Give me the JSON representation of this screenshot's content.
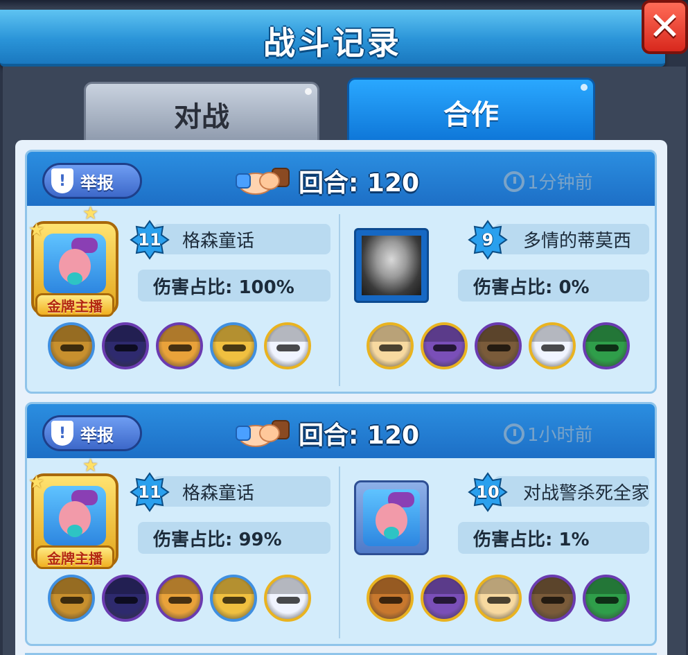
{
  "header": {
    "title": "战斗记录",
    "close_label": "✕"
  },
  "tabs": [
    {
      "label": "对战",
      "active": false
    },
    {
      "label": "合作",
      "active": true
    }
  ],
  "records": [
    {
      "report_label": "举报",
      "rounds_text": "回合: 120",
      "time_text": "1分钟前",
      "left": {
        "level": "11",
        "name": "格森童话",
        "damage_text": "伤害占比: 100%",
        "badge_text": "金牌主播",
        "heroes": [
          {
            "icon": "detective-hero-icon",
            "color": "#c8902e",
            "ring": "blue"
          },
          {
            "icon": "police-hero-icon",
            "color": "#2e2a6e",
            "ring": "purple"
          },
          {
            "icon": "cowboy-hero-icon",
            "color": "#e9a23a",
            "ring": "purple"
          },
          {
            "icon": "knight-hero-icon",
            "color": "#f0c040",
            "ring": "blue"
          },
          {
            "icon": "clown-hero-icon",
            "color": "#f0f4ff",
            "ring": "gold"
          }
        ]
      },
      "right": {
        "level": "9",
        "name": "多情的蒂莫西",
        "damage_text": "伤害占比: 0%",
        "heroes": [
          {
            "icon": "hooded-hero-icon",
            "color": "#f7d9a0",
            "ring": "gold"
          },
          {
            "icon": "pirate-octopus-hero-icon",
            "color": "#7a4fb8",
            "ring": "gold"
          },
          {
            "icon": "masked-hero-icon",
            "color": "#7a5b3a",
            "ring": "purple"
          },
          {
            "icon": "clown-hero-icon",
            "color": "#f0f4ff",
            "ring": "gold"
          },
          {
            "icon": "green-hat-hero-icon",
            "color": "#2f9e4a",
            "ring": "purple"
          }
        ]
      }
    },
    {
      "report_label": "举报",
      "rounds_text": "回合: 120",
      "time_text": "1小时前",
      "left": {
        "level": "11",
        "name": "格森童话",
        "damage_text": "伤害占比: 99%",
        "badge_text": "金牌主播",
        "heroes": [
          {
            "icon": "detective-hero-icon",
            "color": "#c8902e",
            "ring": "blue"
          },
          {
            "icon": "police-hero-icon",
            "color": "#2e2a6e",
            "ring": "purple"
          },
          {
            "icon": "cowboy-hero-icon",
            "color": "#e9a23a",
            "ring": "purple"
          },
          {
            "icon": "knight-hero-icon",
            "color": "#f0c040",
            "ring": "blue"
          },
          {
            "icon": "clown-hero-icon",
            "color": "#f0f4ff",
            "ring": "gold"
          }
        ]
      },
      "right": {
        "level": "10",
        "name": "对战警杀死全家",
        "damage_text": "伤害占比: 1%",
        "heroes": [
          {
            "icon": "chef-hero-icon",
            "color": "#c8782e",
            "ring": "gold"
          },
          {
            "icon": "pirate-octopus-hero-icon",
            "color": "#7a4fb8",
            "ring": "gold"
          },
          {
            "icon": "hooded-hero-icon",
            "color": "#f7d9a0",
            "ring": "gold"
          },
          {
            "icon": "masked-hero-icon",
            "color": "#7a5b3a",
            "ring": "purple"
          },
          {
            "icon": "green-hat-hero-icon",
            "color": "#2f9e4a",
            "ring": "purple"
          }
        ]
      }
    }
  ],
  "colors": {
    "accent": "#1d6fc6",
    "card_bg": "#d3ecfb",
    "ring_purple": "#6a3bb0",
    "ring_gold": "#e9b320",
    "ring_blue": "#3f8fe0"
  }
}
